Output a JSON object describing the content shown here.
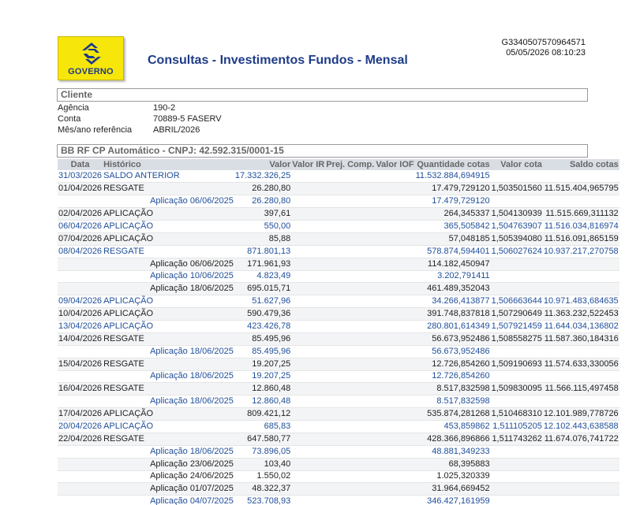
{
  "header": {
    "logo_text": "GOVERNO",
    "title": "Consultas - Investimentos Fundos - Mensal",
    "code": "G3340507570964571",
    "datetime": "05/05/2026 08:10:23"
  },
  "client": {
    "section_title": "Cliente",
    "fields": [
      {
        "label": "Agência",
        "value": "190-2"
      },
      {
        "label": "Conta",
        "value": "70889-5 FASERV"
      },
      {
        "label": "Mês/ano referência",
        "value": "ABRIL/2026"
      }
    ]
  },
  "fund": {
    "section_title": "BB RF CP Automático - CNPJ: 42.592.315/0001-15",
    "columns": [
      "Data",
      "Histórico",
      "Valor",
      "Valor IR",
      "Prej. Comp.",
      "Valor IOF",
      "Quantidade cotas",
      "Valor cota",
      "Saldo cotas"
    ],
    "rows": [
      {
        "date": "31/03/2026",
        "hist": "SALDO ANTERIOR",
        "valor": "17.332.326,25",
        "ir": "",
        "prej": "",
        "iof": "",
        "qtd": "11.532.884,694915",
        "cota": "",
        "saldo": "",
        "sub": false,
        "color": "blue"
      },
      {
        "date": "01/04/2026",
        "hist": "RESGATE",
        "valor": "26.280,80",
        "ir": "",
        "prej": "",
        "iof": "",
        "qtd": "17.479,729120",
        "cota": "1,503501560",
        "saldo": "11.515.404,965795",
        "sub": false,
        "color": "dark"
      },
      {
        "date": "",
        "hist": "Aplicação 06/06/2025",
        "valor": "26.280,80",
        "ir": "",
        "prej": "",
        "iof": "",
        "qtd": "17.479,729120",
        "cota": "",
        "saldo": "",
        "sub": true,
        "color": "blue"
      },
      {
        "date": "02/04/2026",
        "hist": "APLICAÇÃO",
        "valor": "397,61",
        "ir": "",
        "prej": "",
        "iof": "",
        "qtd": "264,345337",
        "cota": "1,504130939",
        "saldo": "11.515.669,311132",
        "sub": false,
        "color": "dark"
      },
      {
        "date": "06/04/2026",
        "hist": "APLICAÇÃO",
        "valor": "550,00",
        "ir": "",
        "prej": "",
        "iof": "",
        "qtd": "365,505842",
        "cota": "1,504763907",
        "saldo": "11.516.034,816974",
        "sub": false,
        "color": "blue"
      },
      {
        "date": "07/04/2026",
        "hist": "APLICAÇÃO",
        "valor": "85,88",
        "ir": "",
        "prej": "",
        "iof": "",
        "qtd": "57,048185",
        "cota": "1,505394080",
        "saldo": "11.516.091,865159",
        "sub": false,
        "color": "dark"
      },
      {
        "date": "08/04/2026",
        "hist": "RESGATE",
        "valor": "871.801,13",
        "ir": "",
        "prej": "",
        "iof": "",
        "qtd": "578.874,594401",
        "cota": "1,506027624",
        "saldo": "10.937.217,270758",
        "sub": false,
        "color": "blue"
      },
      {
        "date": "",
        "hist": "Aplicação 06/06/2025",
        "valor": "171.961,93",
        "ir": "",
        "prej": "",
        "iof": "",
        "qtd": "114.182,450947",
        "cota": "",
        "saldo": "",
        "sub": true,
        "color": "dark"
      },
      {
        "date": "",
        "hist": "Aplicação 10/06/2025",
        "valor": "4.823,49",
        "ir": "",
        "prej": "",
        "iof": "",
        "qtd": "3.202,791411",
        "cota": "",
        "saldo": "",
        "sub": true,
        "color": "blue"
      },
      {
        "date": "",
        "hist": "Aplicação 18/06/2025",
        "valor": "695.015,71",
        "ir": "",
        "prej": "",
        "iof": "",
        "qtd": "461.489,352043",
        "cota": "",
        "saldo": "",
        "sub": true,
        "color": "dark"
      },
      {
        "date": "09/04/2026",
        "hist": "APLICAÇÃO",
        "valor": "51.627,96",
        "ir": "",
        "prej": "",
        "iof": "",
        "qtd": "34.266,413877",
        "cota": "1,506663644",
        "saldo": "10.971.483,684635",
        "sub": false,
        "color": "blue"
      },
      {
        "date": "10/04/2026",
        "hist": "APLICAÇÃO",
        "valor": "590.479,36",
        "ir": "",
        "prej": "",
        "iof": "",
        "qtd": "391.748,837818",
        "cota": "1,507290649",
        "saldo": "11.363.232,522453",
        "sub": false,
        "color": "dark"
      },
      {
        "date": "13/04/2026",
        "hist": "APLICAÇÃO",
        "valor": "423.426,78",
        "ir": "",
        "prej": "",
        "iof": "",
        "qtd": "280.801,614349",
        "cota": "1,507921459",
        "saldo": "11.644.034,136802",
        "sub": false,
        "color": "blue"
      },
      {
        "date": "14/04/2026",
        "hist": "RESGATE",
        "valor": "85.495,96",
        "ir": "",
        "prej": "",
        "iof": "",
        "qtd": "56.673,952486",
        "cota": "1,508558275",
        "saldo": "11.587.360,184316",
        "sub": false,
        "color": "dark"
      },
      {
        "date": "",
        "hist": "Aplicação 18/06/2025",
        "valor": "85.495,96",
        "ir": "",
        "prej": "",
        "iof": "",
        "qtd": "56.673,952486",
        "cota": "",
        "saldo": "",
        "sub": true,
        "color": "blue"
      },
      {
        "date": "15/04/2026",
        "hist": "RESGATE",
        "valor": "19.207,25",
        "ir": "",
        "prej": "",
        "iof": "",
        "qtd": "12.726,854260",
        "cota": "1,509190693",
        "saldo": "11.574.633,330056",
        "sub": false,
        "color": "dark"
      },
      {
        "date": "",
        "hist": "Aplicação 18/06/2025",
        "valor": "19.207,25",
        "ir": "",
        "prej": "",
        "iof": "",
        "qtd": "12.726,854260",
        "cota": "",
        "saldo": "",
        "sub": true,
        "color": "blue"
      },
      {
        "date": "16/04/2026",
        "hist": "RESGATE",
        "valor": "12.860,48",
        "ir": "",
        "prej": "",
        "iof": "",
        "qtd": "8.517,832598",
        "cota": "1,509830095",
        "saldo": "11.566.115,497458",
        "sub": false,
        "color": "dark"
      },
      {
        "date": "",
        "hist": "Aplicação 18/06/2025",
        "valor": "12.860,48",
        "ir": "",
        "prej": "",
        "iof": "",
        "qtd": "8.517,832598",
        "cota": "",
        "saldo": "",
        "sub": true,
        "color": "blue"
      },
      {
        "date": "17/04/2026",
        "hist": "APLICAÇÃO",
        "valor": "809.421,12",
        "ir": "",
        "prej": "",
        "iof": "",
        "qtd": "535.874,281268",
        "cota": "1,510468310",
        "saldo": "12.101.989,778726",
        "sub": false,
        "color": "dark"
      },
      {
        "date": "20/04/2026",
        "hist": "APLICAÇÃO",
        "valor": "685,83",
        "ir": "",
        "prej": "",
        "iof": "",
        "qtd": "453,859862",
        "cota": "1,511105205",
        "saldo": "12.102.443,638588",
        "sub": false,
        "color": "blue"
      },
      {
        "date": "22/04/2026",
        "hist": "RESGATE",
        "valor": "647.580,77",
        "ir": "",
        "prej": "",
        "iof": "",
        "qtd": "428.366,896866",
        "cota": "1,511743262",
        "saldo": "11.674.076,741722",
        "sub": false,
        "color": "dark"
      },
      {
        "date": "",
        "hist": "Aplicação 18/06/2025",
        "valor": "73.896,05",
        "ir": "",
        "prej": "",
        "iof": "",
        "qtd": "48.881,349233",
        "cota": "",
        "saldo": "",
        "sub": true,
        "color": "blue"
      },
      {
        "date": "",
        "hist": "Aplicação 23/06/2025",
        "valor": "103,40",
        "ir": "",
        "prej": "",
        "iof": "",
        "qtd": "68,395883",
        "cota": "",
        "saldo": "",
        "sub": true,
        "color": "dark"
      },
      {
        "date": "",
        "hist": "Aplicação 24/06/2025",
        "valor": "1.550,02",
        "ir": "",
        "prej": "",
        "iof": "",
        "qtd": "1.025,320339",
        "cota": "",
        "saldo": "",
        "sub": true,
        "color": "dark"
      },
      {
        "date": "",
        "hist": "Aplicação 01/07/2025",
        "valor": "48.322,37",
        "ir": "",
        "prej": "",
        "iof": "",
        "qtd": "31.964,669452",
        "cota": "",
        "saldo": "",
        "sub": true,
        "color": "dark"
      },
      {
        "date": "",
        "hist": "Aplicação 04/07/2025",
        "valor": "523.708,93",
        "ir": "",
        "prej": "",
        "iof": "",
        "qtd": "346.427,161959",
        "cota": "",
        "saldo": "",
        "sub": true,
        "color": "blue"
      }
    ]
  },
  "colors": {
    "title": "#1f3c88",
    "logo_bg": "#f6e60a",
    "link_blue": "#1f4e9a",
    "header_bg": "#d9dde4"
  }
}
